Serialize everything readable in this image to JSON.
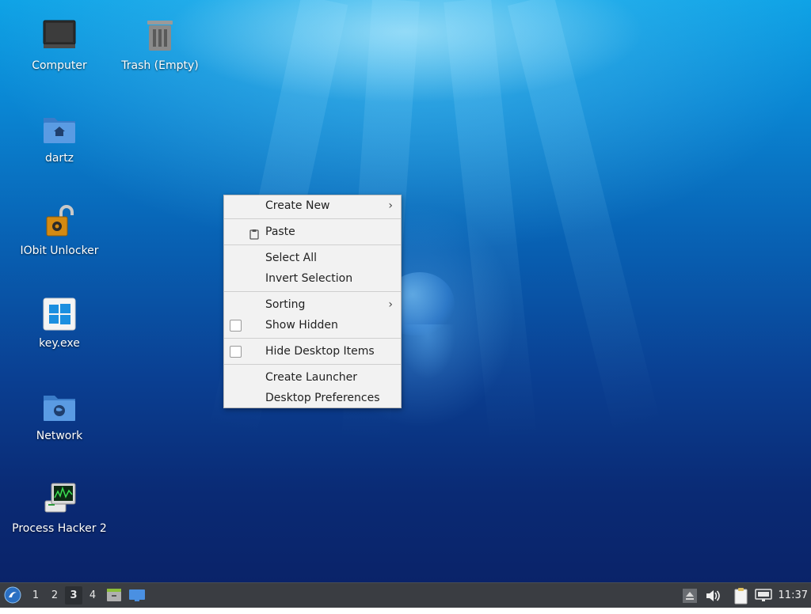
{
  "desktop": {
    "icons": [
      {
        "label": "Computer",
        "icon": "computer-monitor-icon"
      },
      {
        "label": "Trash (Empty)",
        "icon": "trash-icon"
      },
      {
        "label": "dartz",
        "icon": "home-folder-icon"
      },
      {
        "label": "IObit Unlocker",
        "icon": "unlock-padlock-icon"
      },
      {
        "label": "key.exe",
        "icon": "windows-logo-icon"
      },
      {
        "label": "Network",
        "icon": "network-folder-icon"
      },
      {
        "label": "Process Hacker 2",
        "icon": "process-hacker-icon"
      }
    ]
  },
  "context_menu": {
    "create_new": "Create New",
    "paste": "Paste",
    "select_all": "Select All",
    "invert_selection": "Invert Selection",
    "sorting": "Sorting",
    "show_hidden": "Show Hidden",
    "hide_desktop_items": "Hide Desktop Items",
    "create_launcher": "Create Launcher",
    "desktop_preferences": "Desktop Preferences",
    "submenu_arrow": "›"
  },
  "taskbar": {
    "workspaces": [
      "1",
      "2",
      "3",
      "4"
    ],
    "active_workspace": "3",
    "clock": "11:37"
  },
  "colors": {
    "taskbar_bg": "#3a3d42",
    "menu_bg": "#f2f2f2",
    "folder_blue": "#4a8fd8"
  }
}
